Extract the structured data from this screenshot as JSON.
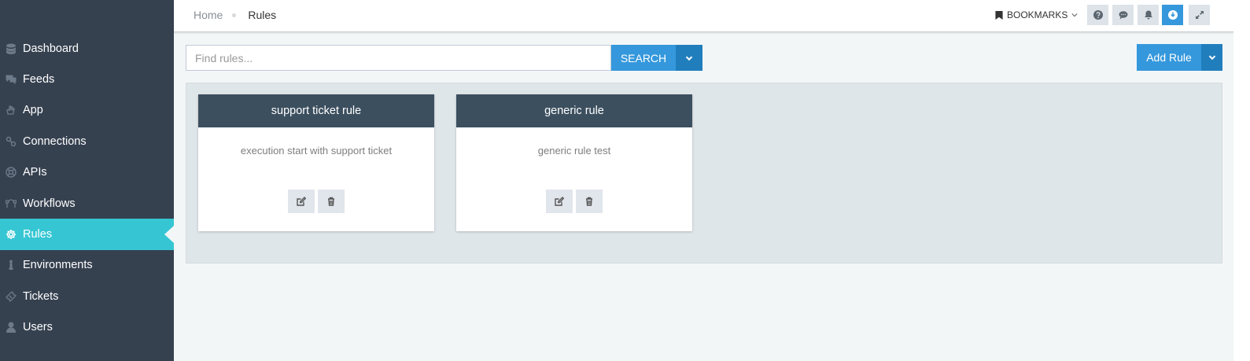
{
  "breadcrumb": {
    "home": "Home",
    "current": "Rules"
  },
  "topbar": {
    "bookmarks_label": "BOOKMARKS"
  },
  "sidebar": {
    "items": [
      {
        "label": "Dashboard",
        "icon": "database-icon"
      },
      {
        "label": "Feeds",
        "icon": "comments-icon"
      },
      {
        "label": "App",
        "icon": "hand-icon"
      },
      {
        "label": "Connections",
        "icon": "link-icon"
      },
      {
        "label": "APIs",
        "icon": "lifebuoy-icon"
      },
      {
        "label": "Workflows",
        "icon": "workflow-icon"
      },
      {
        "label": "Rules",
        "icon": "gear-icon",
        "active": true
      },
      {
        "label": "Environments",
        "icon": "info-icon"
      },
      {
        "label": "Tickets",
        "icon": "ticket-icon"
      },
      {
        "label": "Users",
        "icon": "user-icon"
      }
    ]
  },
  "search": {
    "placeholder": "Find rules...",
    "button_label": "SEARCH"
  },
  "add_rule": {
    "label": "Add Rule"
  },
  "rules": [
    {
      "title": "support ticket rule",
      "description": "execution start with support ticket"
    },
    {
      "title": "generic rule",
      "description": "generic rule test"
    }
  ],
  "colors": {
    "sidebar_bg": "#364150",
    "active": "#36c6d3",
    "primary": "#3598dc",
    "card_header": "#3c4f5f"
  }
}
